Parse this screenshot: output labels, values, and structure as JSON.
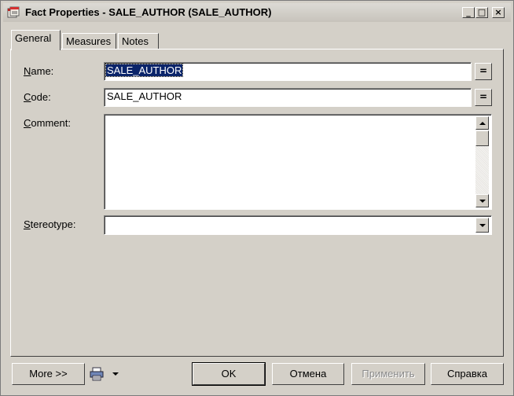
{
  "window": {
    "title": "Fact Properties - SALE_AUTHOR (SALE_AUTHOR)",
    "controls": {
      "minimize": "_",
      "maximize": "□",
      "close": "×"
    }
  },
  "tabs": [
    {
      "label": "General",
      "active": true
    },
    {
      "label": "Measures",
      "active": false
    },
    {
      "label": "Notes",
      "active": false
    }
  ],
  "form": {
    "name": {
      "label_mnemonic": "N",
      "label_rest": "ame:",
      "value": "SALE_AUTHOR",
      "button": "="
    },
    "code": {
      "label_mnemonic": "C",
      "label_rest": "ode:",
      "value": "SALE_AUTHOR",
      "button": "="
    },
    "comment": {
      "label_mnemonic": "C",
      "label_rest": "omment:",
      "value": ""
    },
    "stereotype": {
      "label_mnemonic": "S",
      "label_rest": "tereotype:",
      "value": ""
    }
  },
  "footer": {
    "more_label": "More >>",
    "ok_label": "OK",
    "cancel_label": "Отмена",
    "apply_label": "Применить",
    "help_label": "Справка"
  },
  "icons": {
    "app": "fact-properties-app-icon",
    "print": "print-icon",
    "dropdown": "chevron-down-icon"
  },
  "colors": {
    "face": "#d4d0c8",
    "selection": "#0a246a",
    "disabled_text": "#8a8a8a"
  }
}
